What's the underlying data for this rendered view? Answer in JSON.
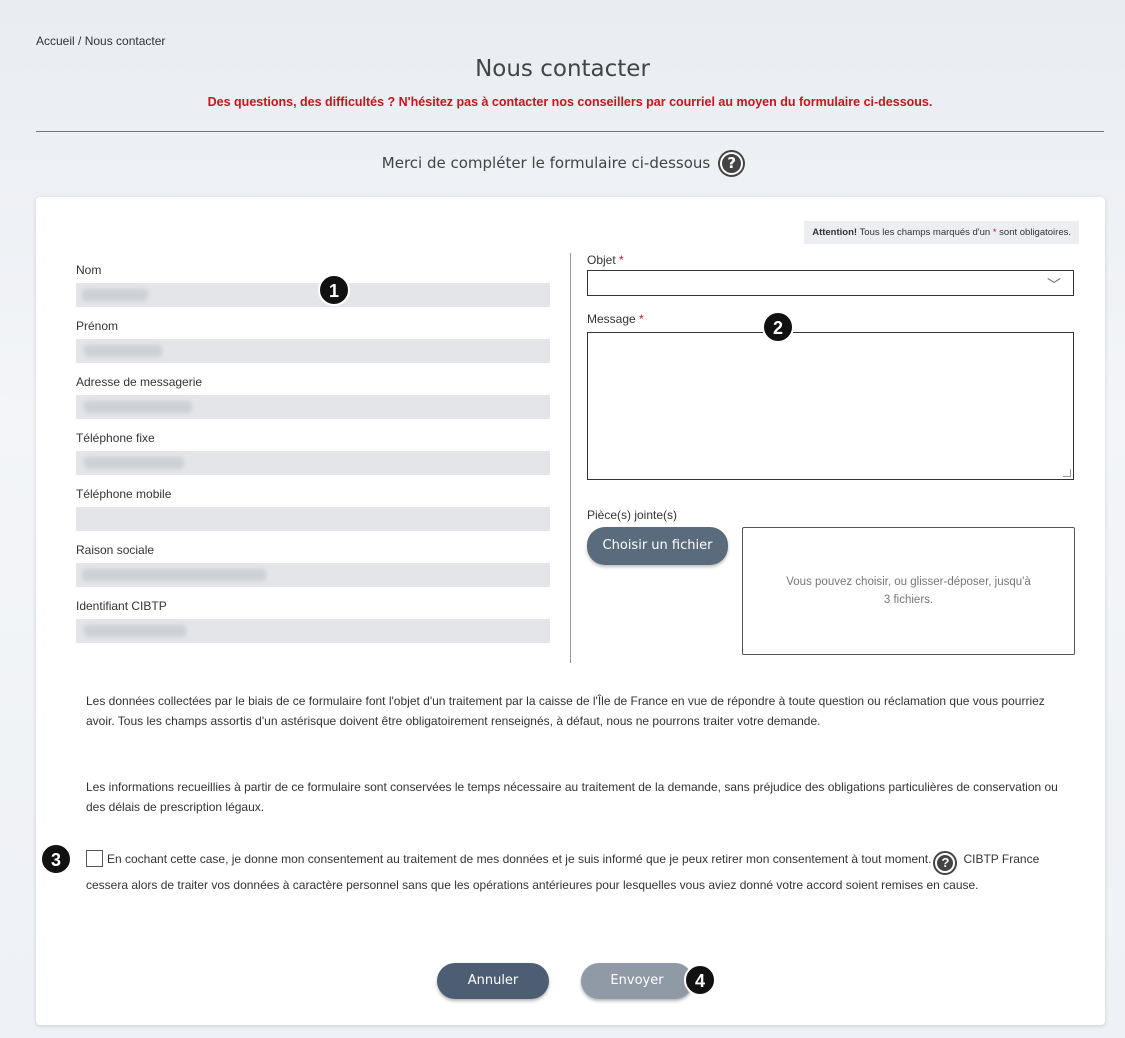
{
  "breadcrumb": {
    "home": "Accueil",
    "separator": " / ",
    "current": "Nous contacter"
  },
  "page": {
    "title": "Nous contacter",
    "subtitle": "Des questions, des difficultés ? N'hésitez pas à contacter nos conseillers par courriel au moyen du formulaire ci-dessous.",
    "form_intro": "Merci de compléter le formulaire ci-dessous",
    "help_icon": "?"
  },
  "colors": {
    "accent_red": "#c4161c",
    "button_dark": "#4e5e72",
    "button_disabled": "#8f9aa6"
  },
  "notice": {
    "strong": "Attention!",
    "text": " Tous les champs marqués d'un ",
    "star": "*",
    "text_end": " sont obligatoires."
  },
  "fields": [
    {
      "label": "Nom"
    },
    {
      "label": "Prénom"
    },
    {
      "label": "Adresse de messagerie"
    },
    {
      "label": "Téléphone fixe"
    },
    {
      "label": "Téléphone mobile"
    },
    {
      "label": "Raison sociale"
    },
    {
      "label": "Identifiant CIBTP"
    }
  ],
  "object": {
    "label": "Objet",
    "star": "*",
    "value": ""
  },
  "message": {
    "label": "Message",
    "star": "*",
    "value": ""
  },
  "attachments": {
    "label": "Pièce(s) jointe(s)",
    "button": "Choisir un fichier",
    "dropzone_text": "Vous pouvez choisir, ou glisser-déposer, jusqu'à 3 fichiers."
  },
  "legal": {
    "p1": "Les données collectées par le biais de ce formulaire font l'objet d'un traitement par la caisse de l'Île de France en vue de répondre à toute question ou réclamation que vous pourriez avoir. Tous les champs assortis d'un astérisque doivent être obligatoirement renseignés, à défaut, nous ne pourrons traiter votre demande.",
    "p2": "Les informations recueillies à partir de ce formulaire sont conservées le temps nécessaire au traitement de la demande, sans préjudice des obligations particulières de conservation ou des délais de prescription légaux."
  },
  "consent": {
    "text1": "En cochant cette case, je donne mon consentement au traitement de mes données et je suis informé que je peux retirer mon consentement à tout moment.",
    "text2": "CIBTP France cessera alors de traiter vos données à caractère personnel sans que les opérations antérieures pour lesquelles vous aviez donné votre accord soient remises en cause."
  },
  "buttons": {
    "cancel": "Annuler",
    "send": "Envoyer"
  },
  "markers": [
    "1",
    "2",
    "3",
    "4"
  ]
}
